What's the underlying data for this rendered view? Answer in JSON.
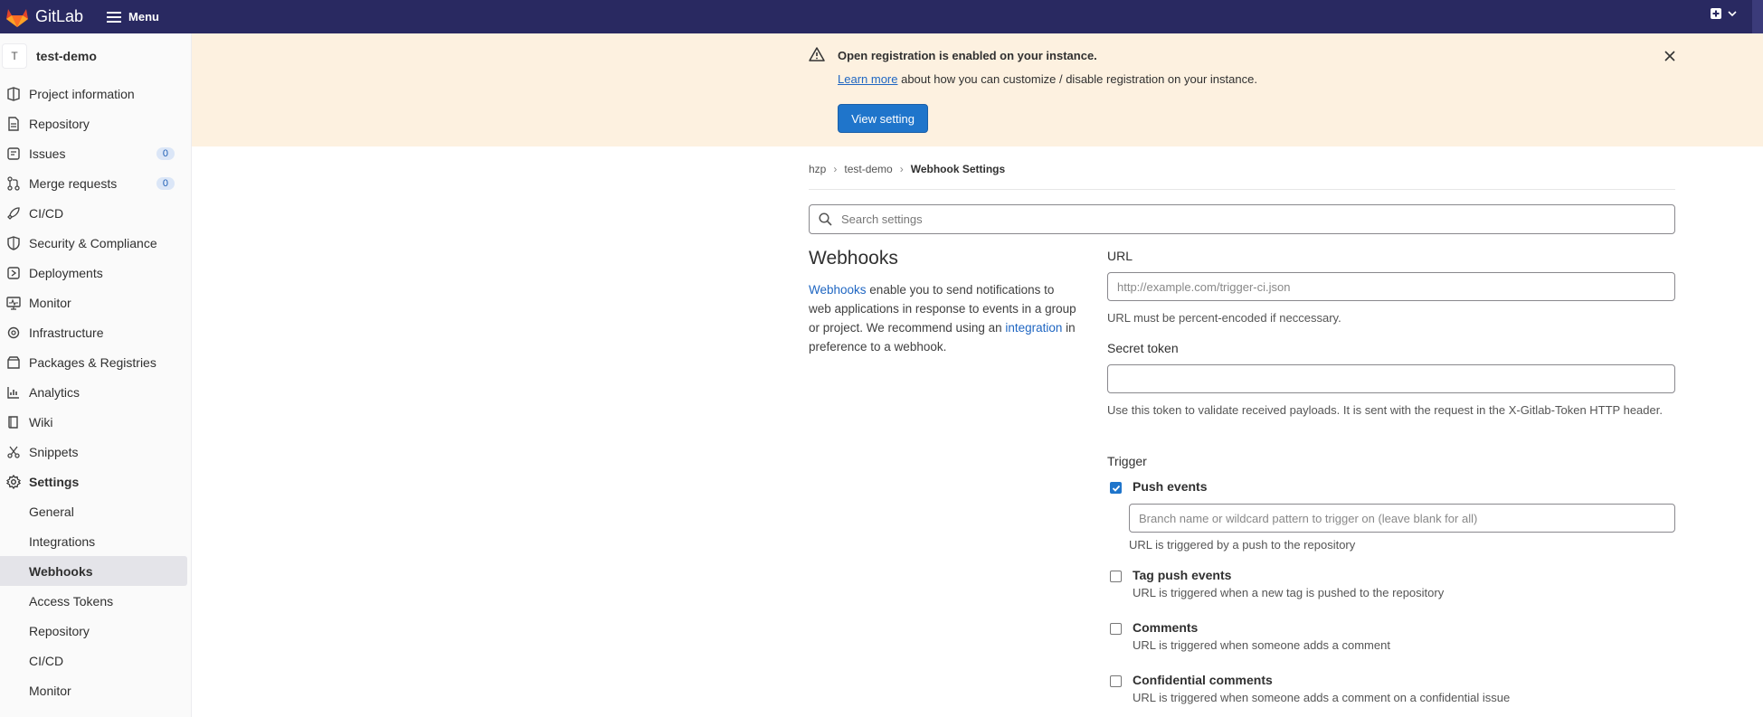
{
  "topbar": {
    "brand": "GitLab",
    "menu_label": "Menu",
    "brand_color": "#292961"
  },
  "sidebar": {
    "project_initial": "T",
    "project_name": "test-demo",
    "items": [
      {
        "label": "Project information",
        "icon": "project-icon"
      },
      {
        "label": "Repository",
        "icon": "repository-icon"
      },
      {
        "label": "Issues",
        "icon": "issues-icon",
        "badge": "0"
      },
      {
        "label": "Merge requests",
        "icon": "merge-request-icon",
        "badge": "0"
      },
      {
        "label": "CI/CD",
        "icon": "rocket-icon"
      },
      {
        "label": "Security & Compliance",
        "icon": "shield-icon"
      },
      {
        "label": "Deployments",
        "icon": "deployments-icon"
      },
      {
        "label": "Monitor",
        "icon": "monitor-icon"
      },
      {
        "label": "Infrastructure",
        "icon": "cloud-gear-icon"
      },
      {
        "label": "Packages & Registries",
        "icon": "package-icon"
      },
      {
        "label": "Analytics",
        "icon": "chart-icon"
      },
      {
        "label": "Wiki",
        "icon": "book-icon"
      },
      {
        "label": "Snippets",
        "icon": "scissors-icon"
      },
      {
        "label": "Settings",
        "icon": "gear-icon"
      }
    ],
    "settings_sub": [
      {
        "label": "General"
      },
      {
        "label": "Integrations"
      },
      {
        "label": "Webhooks",
        "active": true
      },
      {
        "label": "Access Tokens"
      },
      {
        "label": "Repository"
      },
      {
        "label": "CI/CD"
      },
      {
        "label": "Monitor"
      }
    ]
  },
  "banner": {
    "title": "Open registration is enabled on your instance.",
    "link_text": "Learn more",
    "body_rest": " about how you can customize / disable registration on your instance.",
    "button": "View setting"
  },
  "breadcrumb": [
    "hzp",
    "test-demo",
    "Webhook Settings"
  ],
  "search": {
    "placeholder": "Search settings"
  },
  "webhooks": {
    "title": "Webhooks",
    "desc_link1": "Webhooks",
    "desc_part1": " enable you to send notifications to web applications in response to events in a group or project. We recommend using an ",
    "desc_link2": "integration",
    "desc_part2": " in preference to a webhook."
  },
  "form": {
    "url_label": "URL",
    "url_placeholder": "http://example.com/trigger-ci.json",
    "url_help": "URL must be percent-encoded if neccessary.",
    "token_label": "Secret token",
    "token_help": "Use this token to validate received payloads. It is sent with the request in the X-Gitlab-Token HTTP header.",
    "trigger_label": "Trigger",
    "push": {
      "title": "Push events",
      "checked": true,
      "branch_placeholder": "Branch name or wildcard pattern to trigger on (leave blank for all)",
      "help": "URL is triggered by a push to the repository"
    },
    "tag_push": {
      "title": "Tag push events",
      "help": "URL is triggered when a new tag is pushed to the repository"
    },
    "comments": {
      "title": "Comments",
      "help": "URL is triggered when someone adds a comment"
    },
    "confidential": {
      "title": "Confidential comments",
      "help": "URL is triggered when someone adds a comment on a confidential issue"
    }
  }
}
